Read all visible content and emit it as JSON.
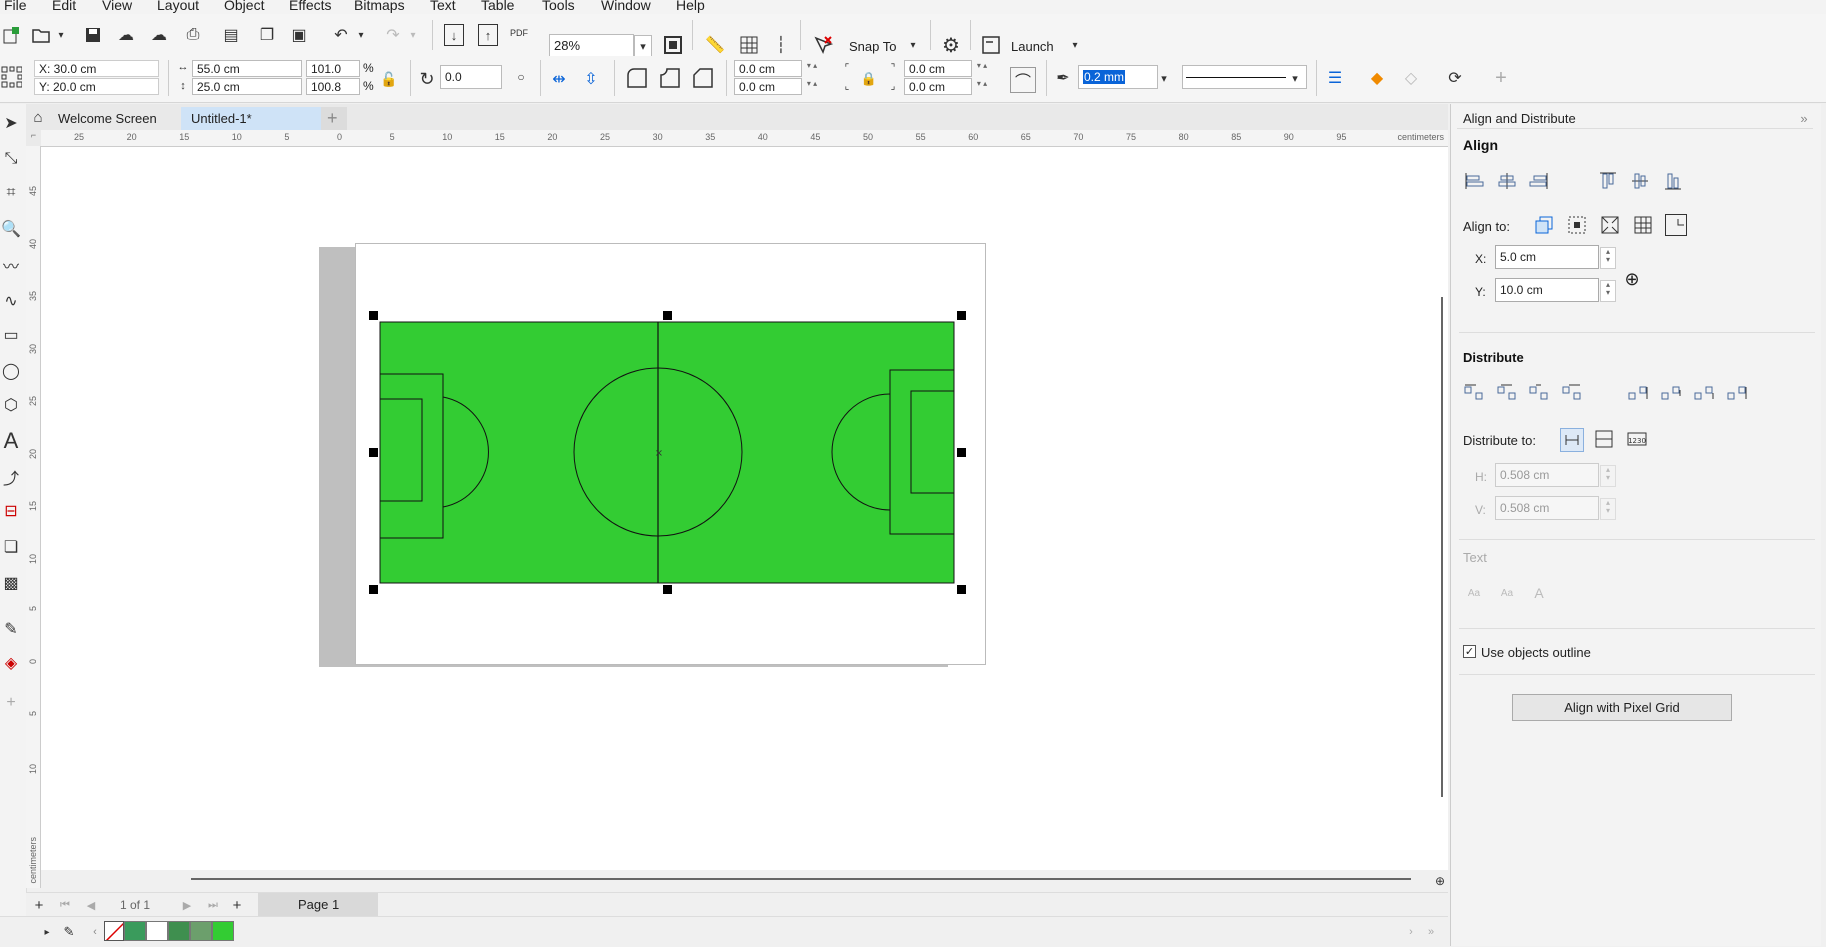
{
  "menu": [
    "File",
    "Edit",
    "View",
    "Layout",
    "Object",
    "Effects",
    "Bitmaps",
    "Text",
    "Table",
    "Tools",
    "Window",
    "Help"
  ],
  "toolbar": {
    "zoom": "28%",
    "snap_to": "Snap To",
    "launch": "Launch",
    "pdf_label": "PDF"
  },
  "properties": {
    "x": "X: 30.0 cm",
    "y": "Y: 20.0 cm",
    "width": "55.0 cm",
    "height": "25.0 cm",
    "scale_w": "101.0",
    "scale_h": "100.8",
    "percent": "%",
    "rotation": "0.0",
    "corner1": "0.0 cm",
    "corner2": "0.0 cm",
    "corner3": "0.0 cm",
    "corner4": "0.0 cm",
    "outline_width": "0.2 mm"
  },
  "tabs": {
    "welcome": "Welcome Screen",
    "document": "Untitled-1*",
    "add": "+"
  },
  "ruler": {
    "h_ticks": [
      "25",
      "20",
      "15",
      "10",
      "5",
      "0",
      "5",
      "10",
      "15",
      "20",
      "25",
      "30",
      "35",
      "40",
      "45",
      "50",
      "55",
      "60",
      "65",
      "70",
      "75",
      "80",
      "85",
      "90",
      "95"
    ],
    "h_unit": "centimeters",
    "v_ticks": [
      "45",
      "40",
      "35",
      "30",
      "25",
      "20",
      "15",
      "10",
      "5",
      "0",
      "5",
      "10"
    ],
    "v_unit": "centimeters"
  },
  "page_nav": {
    "page_count": "1 of 1",
    "page_tab": "Page 1"
  },
  "palette": {
    "swatches": [
      "#3a9b5c",
      "#ffffff",
      "#3f8f4f",
      "#6c9f6c",
      "#33cc33"
    ]
  },
  "docker": {
    "title": "Align and Distribute",
    "align_header": "Align",
    "align_to_label": "Align to:",
    "x_label": "X:",
    "x_value": "5.0 cm",
    "y_label": "Y:",
    "y_value": "10.0 cm",
    "distribute_header": "Distribute",
    "distribute_to_label": "Distribute to:",
    "h_label": "H:",
    "h_value": "0.508 cm",
    "v_label": "V:",
    "v_value": "0.508 cm",
    "text_header": "Text",
    "use_outline_label": "Use objects outline",
    "pixel_grid_button": "Align with Pixel Grid"
  },
  "colors": {
    "pitch": "#33cc33",
    "selection_tab": "#cfe3f7",
    "outline_highlight": "#0a64d8"
  }
}
